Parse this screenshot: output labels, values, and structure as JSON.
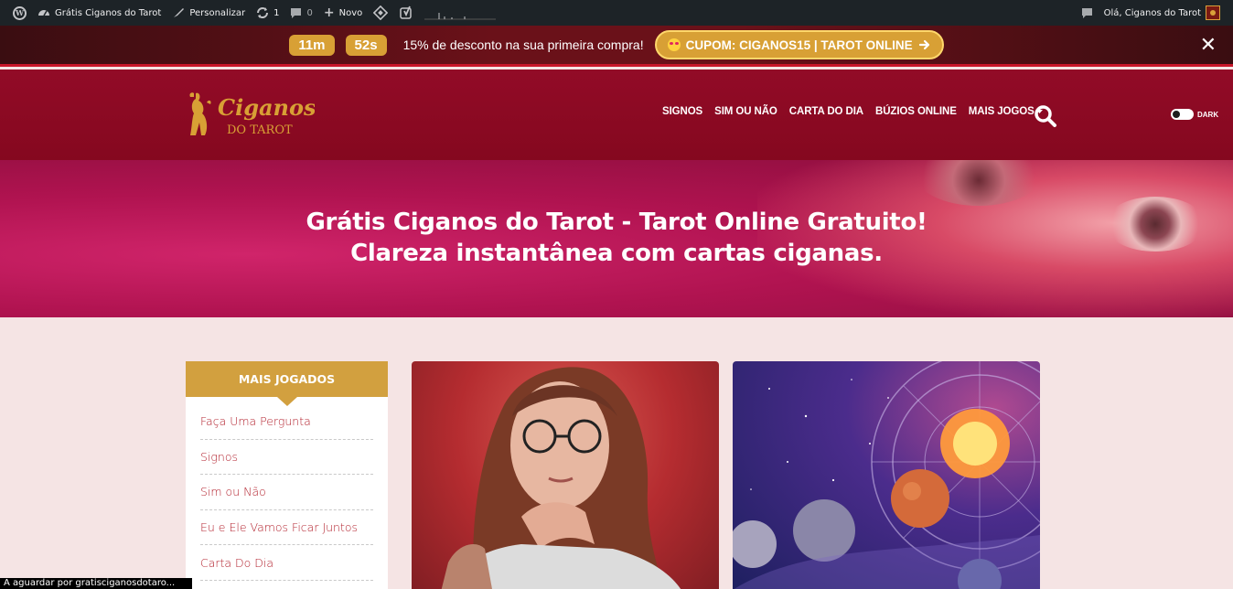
{
  "admin_bar": {
    "site_name": "Grátis Ciganos do Tarot",
    "customize": "Personalizar",
    "updates_count": "1",
    "comments_count": "0",
    "new_label": "Novo",
    "greeting": "Olá, Ciganos do Tarot"
  },
  "promo": {
    "timer_minutes": "11m",
    "timer_seconds": "52s",
    "text": "15% de desconto na sua primeira compra!",
    "coupon_label": "CUPOM: CIGANOS15 | TAROT ONLINE",
    "close": "✕"
  },
  "header": {
    "logo_line1": "Ciganos",
    "logo_line2": "DO TAROT",
    "nav": [
      "SIGNOS",
      "SIM OU NÃO",
      "CARTA DO DIA",
      "BÚZIOS ONLINE",
      "MAIS JOGOS"
    ],
    "dark_label": "DARK"
  },
  "hero": {
    "title_line1": "Grátis Ciganos do Tarot - Tarot Online Gratuito!",
    "title_line2": "Clareza instantânea com cartas ciganas."
  },
  "sidebar": {
    "title": "MAIS JOGADOS",
    "items": [
      "Faça Uma Pergunta",
      "Signos",
      "Sim ou Não",
      "Eu e Ele Vamos Ficar Juntos",
      "Carta Do Dia"
    ]
  },
  "status_bar": "A aguardar por gratisciganosdotaro...",
  "colors": {
    "admin_bar": "#1d2327",
    "header": "#8a0a24",
    "gold": "#d2a03f",
    "link": "#b3222e",
    "page_bg": "#f5e4e4"
  }
}
